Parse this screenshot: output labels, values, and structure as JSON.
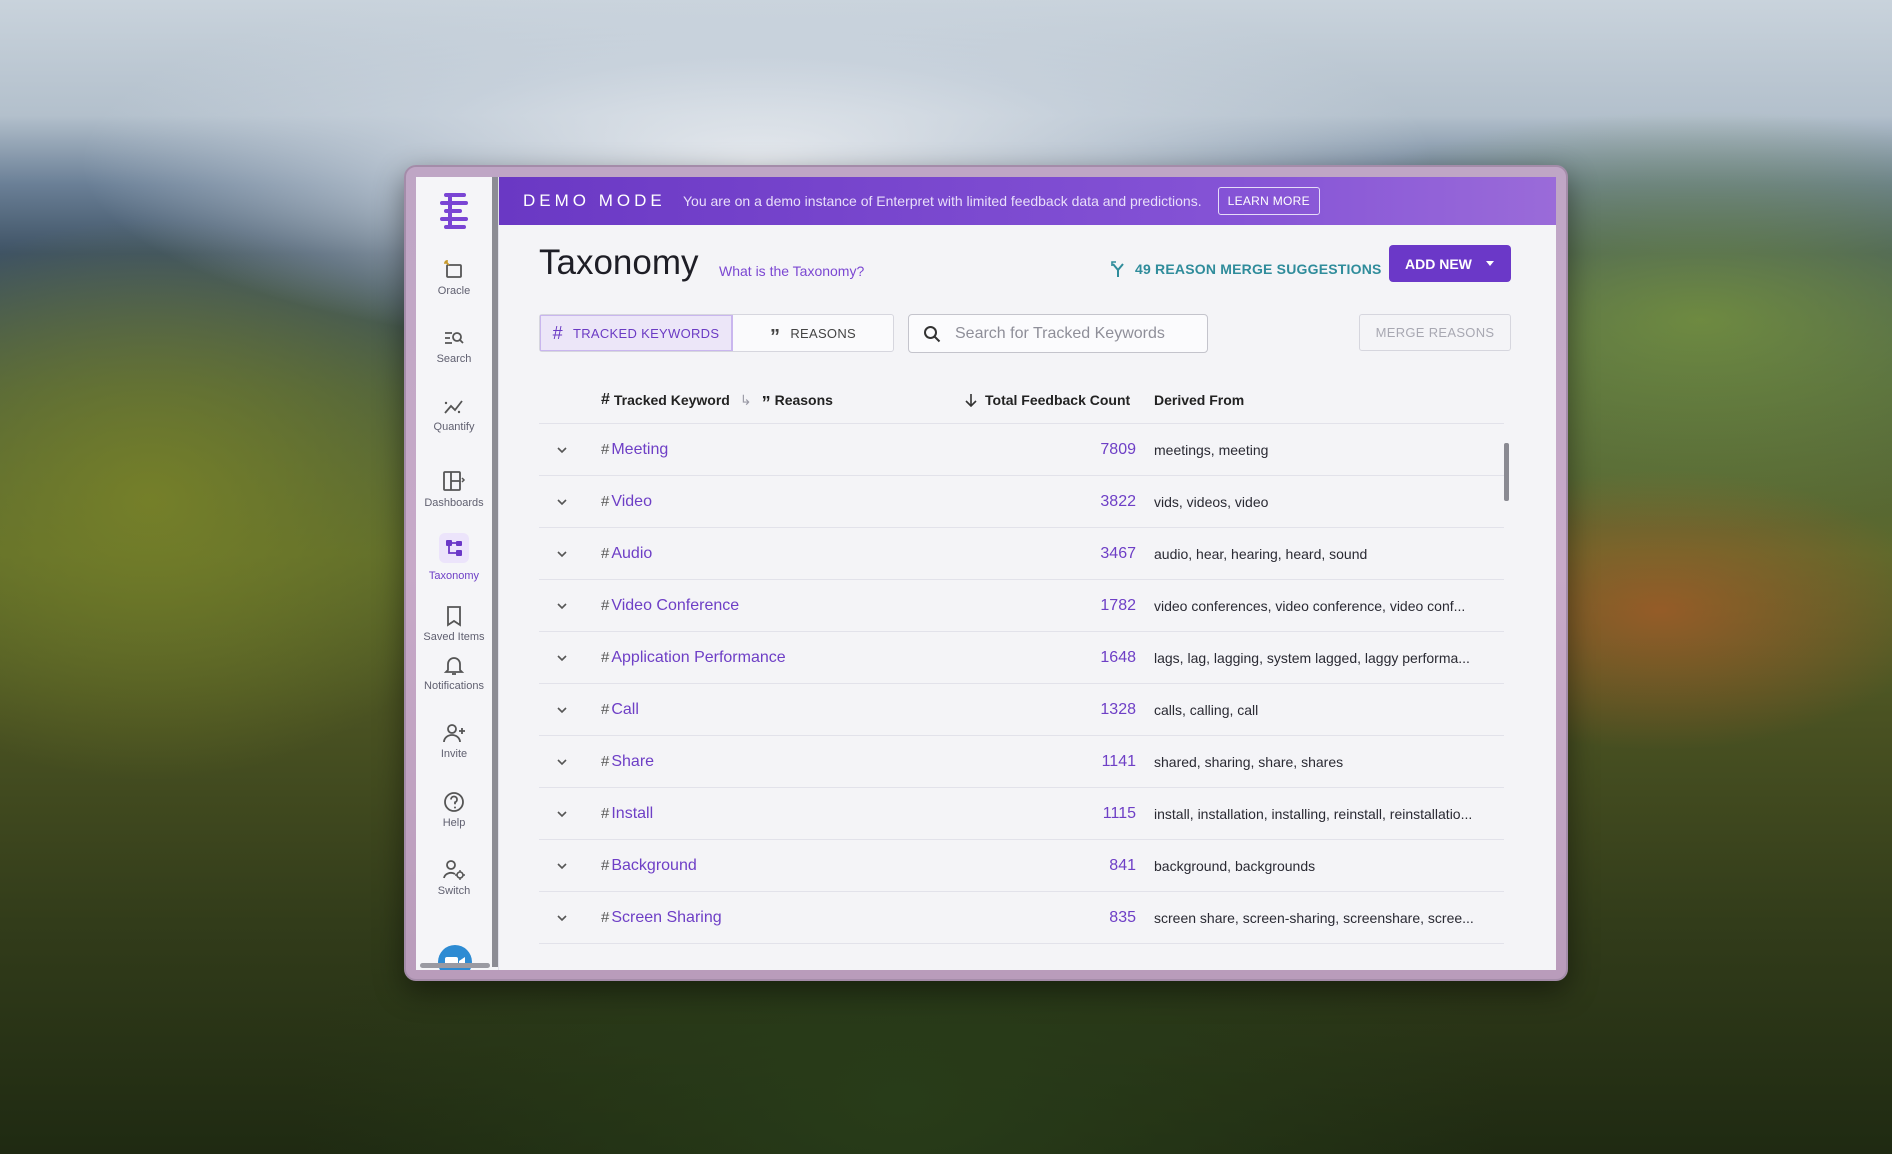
{
  "banner": {
    "mode": "DEMO MODE",
    "message": "You are on a demo instance of Enterpret with limited feedback data and predictions.",
    "learn_more": "LEARN MORE"
  },
  "sidebar": {
    "items": [
      {
        "label": "Oracle",
        "icon": "oracle-icon"
      },
      {
        "label": "Search",
        "icon": "search-icon"
      },
      {
        "label": "Quantify",
        "icon": "quantify-icon"
      },
      {
        "label": "Dashboards",
        "icon": "dashboards-icon"
      },
      {
        "label": "Taxonomy",
        "icon": "taxonomy-icon",
        "active": true
      },
      {
        "label": "Saved Items",
        "icon": "bookmark-icon"
      },
      {
        "label": "Notifications",
        "icon": "bell-icon"
      },
      {
        "label": "Invite",
        "icon": "add-user-icon"
      },
      {
        "label": "Help",
        "icon": "help-icon"
      },
      {
        "label": "Switch",
        "icon": "switch-user-icon"
      }
    ]
  },
  "header": {
    "title": "Taxonomy",
    "what_link": "What is the Taxonomy?",
    "merge_suggestions": "49 REASON MERGE SUGGESTIONS",
    "add_new": "ADD NEW"
  },
  "tabs": [
    {
      "label": "TRACKED KEYWORDS",
      "active": true
    },
    {
      "label": "REASONS",
      "active": false
    }
  ],
  "search": {
    "placeholder": "Search for Tracked Keywords",
    "value": ""
  },
  "merge_reasons": "MERGE REASONS",
  "table": {
    "headers": {
      "keyword": "Tracked Keyword",
      "reasons": "Reasons",
      "count": "Total Feedback Count",
      "derived": "Derived From"
    },
    "rows": [
      {
        "keyword": "Meeting",
        "count": "7809",
        "derived": "meetings, meeting"
      },
      {
        "keyword": "Video",
        "count": "3822",
        "derived": "vids, videos, video"
      },
      {
        "keyword": "Audio",
        "count": "3467",
        "derived": "audio, hear, hearing, heard, sound"
      },
      {
        "keyword": "Video Conference",
        "count": "1782",
        "derived": "video conferences, video conference, video conf..."
      },
      {
        "keyword": "Application Performance",
        "count": "1648",
        "derived": "lags, lag, lagging, system lagged, laggy performa..."
      },
      {
        "keyword": "Call",
        "count": "1328",
        "derived": "calls, calling, call"
      },
      {
        "keyword": "Share",
        "count": "1141",
        "derived": "shared, sharing, share, shares"
      },
      {
        "keyword": "Install",
        "count": "1115",
        "derived": "install, installation, installing, reinstall, reinstallatio..."
      },
      {
        "keyword": "Background",
        "count": "841",
        "derived": "background, backgrounds"
      },
      {
        "keyword": "Screen Sharing",
        "count": "835",
        "derived": "screen share, screen-sharing, screenshare, scree..."
      }
    ]
  },
  "colors": {
    "accent": "#6b38c8",
    "teal": "#2f8c9b"
  }
}
